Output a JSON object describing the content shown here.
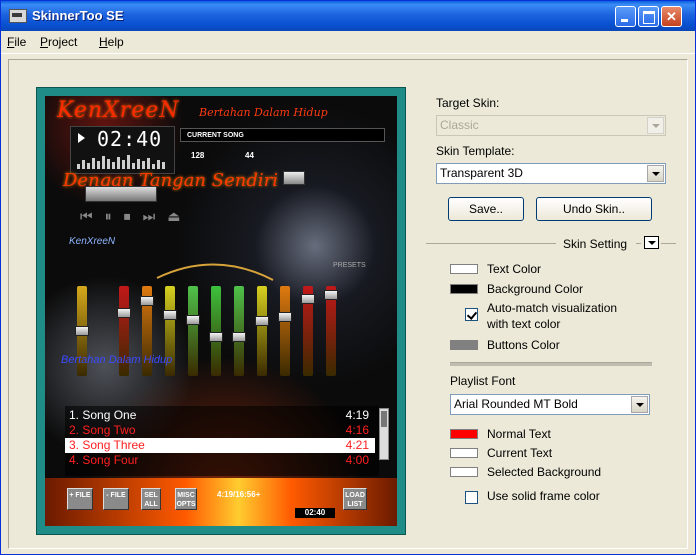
{
  "window": {
    "title": "SkinnerToo SE"
  },
  "menu": [
    {
      "first": "F",
      "rest": "ile"
    },
    {
      "first": "P",
      "rest": "roject"
    },
    {
      "first": "H",
      "rest": "elp"
    }
  ],
  "preview": {
    "title": "KenXreeN",
    "subtitle_top": "Bertahan Dalam Hidup",
    "subtitle_mid": "Dengan Tangan Sendiri",
    "time": "02:40",
    "song_label": "CURRENT SONG",
    "bitrate": "128",
    "khz": "44",
    "blue_text": "KenXreeN",
    "blue_text_2": "Bertahan Dalam Hidup",
    "presets": "PRESETS",
    "eq_levels": [
      0.5,
      0.28,
      0.12,
      0.3,
      0.36,
      0.58,
      0.58,
      0.38,
      0.32,
      0.1,
      0.05
    ],
    "playlist": [
      {
        "title": "1. Song One",
        "duration": "4:19"
      },
      {
        "title": "2. Song Two",
        "duration": "4:16"
      },
      {
        "title": "3. Song Three",
        "duration": "4:21"
      },
      {
        "title": "4. Song Four",
        "duration": "4:00"
      }
    ],
    "buttons": {
      "add_file": "+ FILE",
      "remove_file": "- FILE",
      "select_all": "SEL ALL",
      "misc_opts": "MISC OPTS",
      "load_list": "LOAD LIST"
    },
    "info": "4:19/16:56+",
    "bottom_time": "02:40"
  },
  "right_panel": {
    "target_skin_label": "Target Skin:",
    "target_skin_value": "Classic",
    "skin_template_label": "Skin Template:",
    "skin_template_value": "Transparent 3D",
    "save_label": "Save..",
    "undo_label": "Undo Skin..",
    "skin_setting_label": "Skin Setting",
    "text_color_label": "Text Color",
    "background_color_label": "Background Color",
    "auto_match_label_1": "Auto-match visualization",
    "auto_match_label_2": "with text color",
    "buttons_color_label": "Buttons Color",
    "playlist_font_label": "Playlist Font",
    "playlist_font_value": "Arial Rounded MT Bold",
    "normal_text_label": "Normal Text",
    "current_text_label": "Current Text",
    "selected_background_label": "Selected Background",
    "solid_frame_label": "Use solid frame color"
  },
  "colors": {
    "text_color": "#ffffff",
    "background_color": "#000000",
    "buttons_color": "#808080",
    "normal_text": "#ff0000",
    "current_text": "#ffffff",
    "selected_background": "#ffffff",
    "preview_frame": "#1f8c87"
  }
}
